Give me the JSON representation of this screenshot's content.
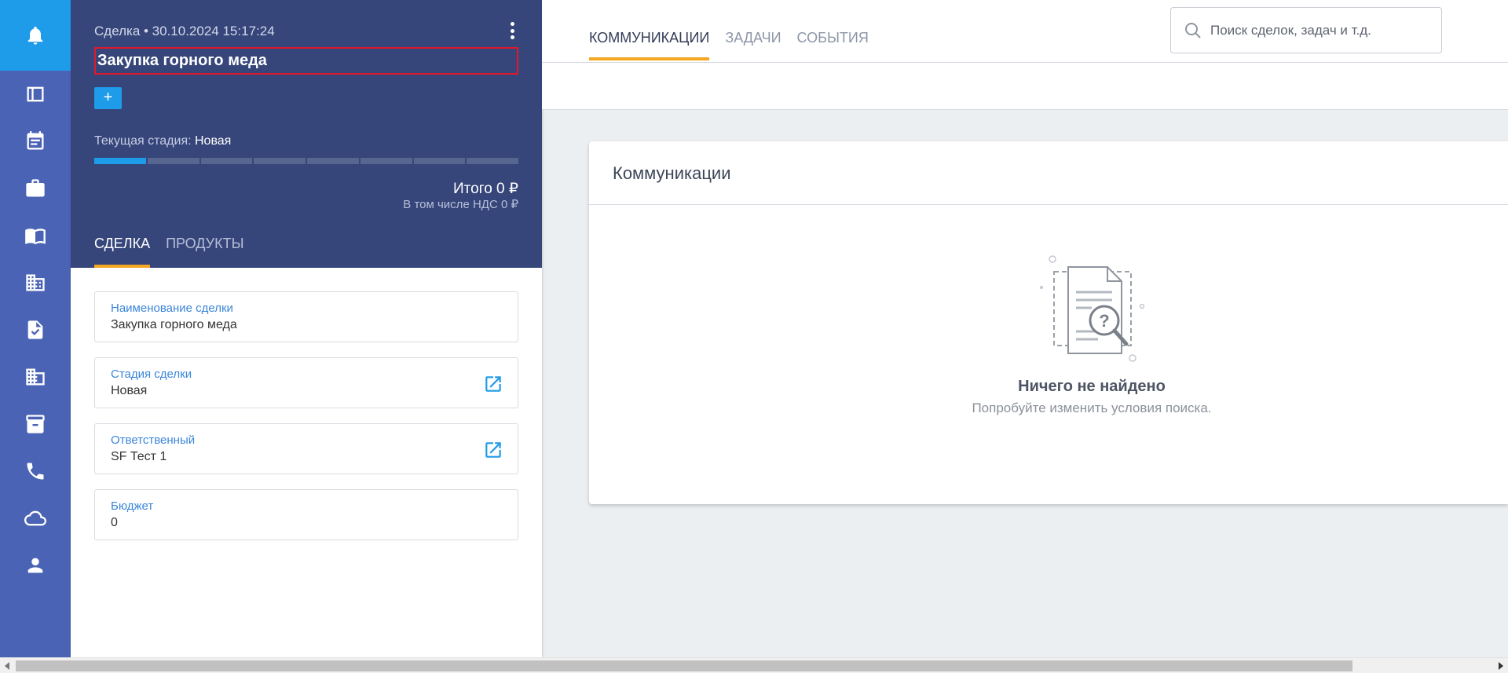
{
  "rail": {
    "icons": [
      "bell-icon",
      "board-icon",
      "calendar-icon",
      "briefcase-icon",
      "book-icon",
      "building-icon",
      "file-check-icon",
      "company-icon",
      "archive-icon",
      "phone-icon",
      "cloud-icon",
      "user-icon"
    ]
  },
  "deal": {
    "meta": "Сделка • 30.10.2024 15:17:24",
    "title": "Закупка горного меда",
    "add_label": "+",
    "stage_prefix": "Текущая стадия: ",
    "stage_name": "Новая",
    "stages_total": 8,
    "stages_done": 1,
    "total": "Итого 0 ₽",
    "vat": "В том числе НДС 0 ₽",
    "tabs": [
      {
        "label": "СДЕЛКА",
        "active": true
      },
      {
        "label": "ПРОДУКТЫ",
        "active": false
      }
    ],
    "fields": [
      {
        "label": "Наименование сделки",
        "value": "Закупка горного меда"
      },
      {
        "label": "Стадия сделки",
        "value": "Новая"
      },
      {
        "label": "Ответственный",
        "value": "SF Тест 1"
      },
      {
        "label": "Бюджет",
        "value": "0"
      }
    ]
  },
  "communications": {
    "tabs": [
      {
        "label": "КОММУНИКАЦИИ",
        "active": true
      },
      {
        "label": "ЗАДАЧИ",
        "active": false
      },
      {
        "label": "СОБЫТИЯ",
        "active": false
      }
    ],
    "search_placeholder": "Поиск сделок, задач и т.д.",
    "card_title": "Коммуникации",
    "empty_title": "Ничего не найдено",
    "empty_subtitle": "Попробуйте изменить условия поиска."
  },
  "colors": {
    "rail": "#4a63b4",
    "rail_active": "#1e9be9",
    "deal_header": "#36467a",
    "accent": "#f5a623",
    "highlight_border": "#e0182d"
  }
}
